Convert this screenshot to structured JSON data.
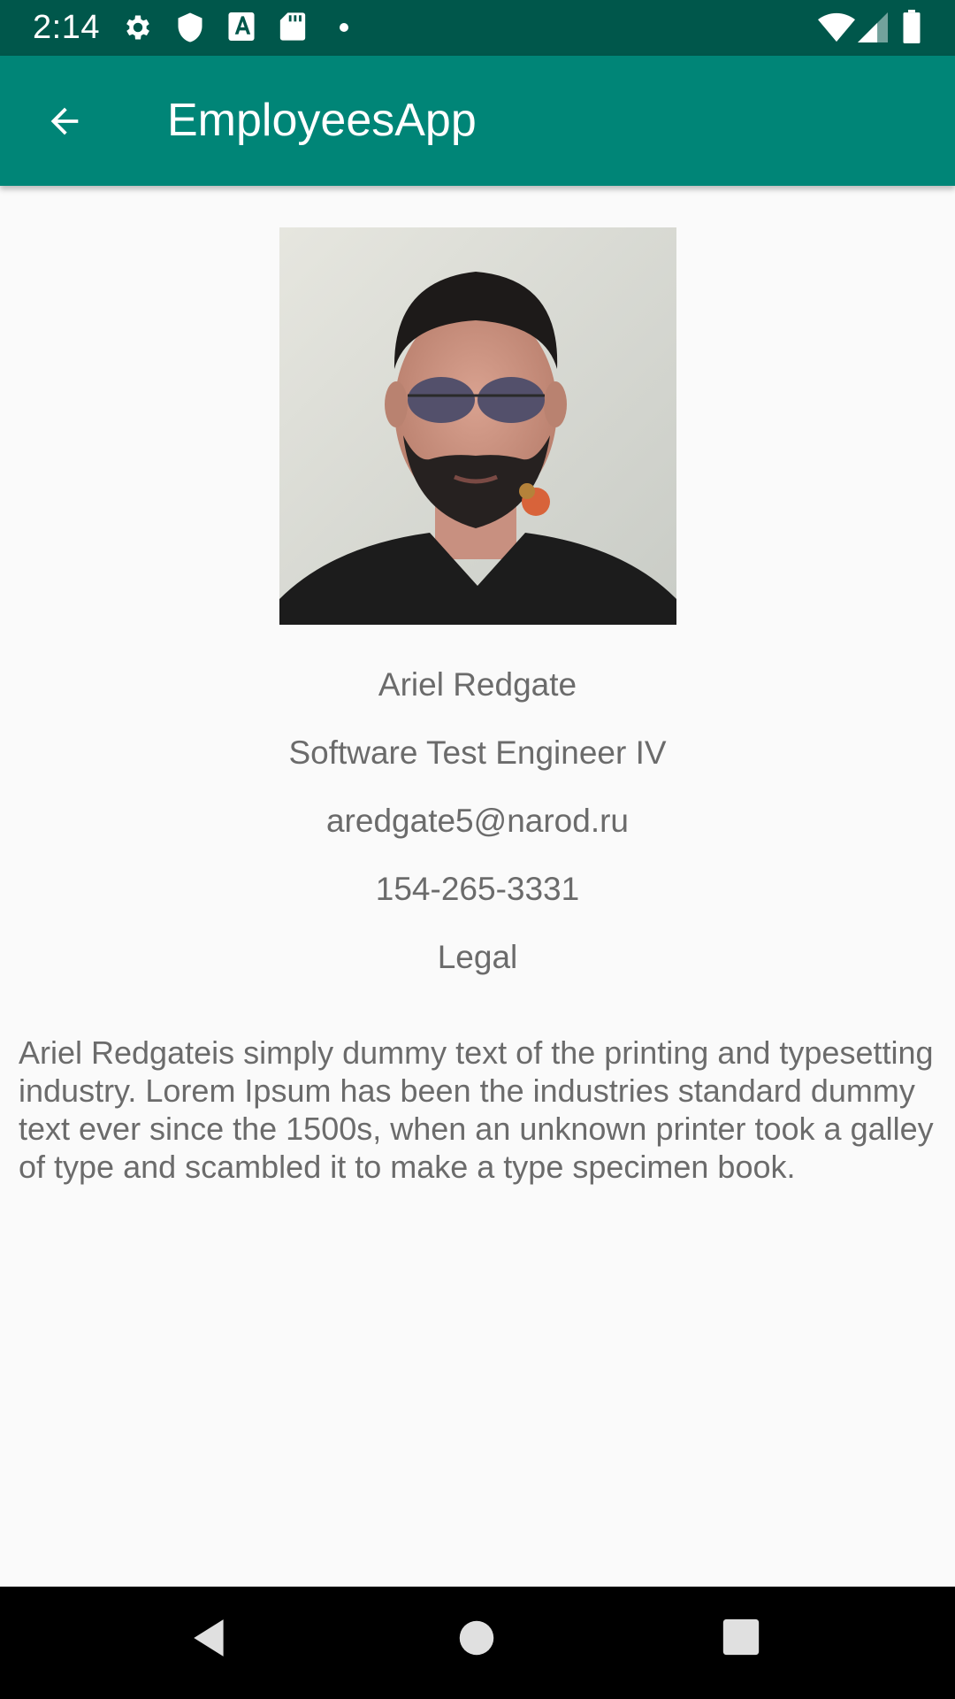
{
  "status_bar": {
    "time": "2:14",
    "icons": [
      "gear-icon",
      "shield-icon",
      "a-badge-icon",
      "sd-card-icon",
      "dot-icon",
      "wifi-icon",
      "signal-icon",
      "battery-icon"
    ]
  },
  "app_bar": {
    "title": "EmployeesApp",
    "back_icon": "arrow-back-icon"
  },
  "employee": {
    "name": "Ariel Redgate",
    "title": "Software Test Engineer IV",
    "email": "aredgate5@narod.ru",
    "phone": "154-265-3331",
    "department": "Legal",
    "bio": "Ariel Redgateis simply dummy text of the printing and typesetting industry. Lorem Ipsum has been the industries standard dummy text ever since the 1500s, when an unknown printer took a galley of type and scambled it to make a type specimen book."
  },
  "nav_bar": {
    "buttons": [
      "back-triangle-icon",
      "home-circle-icon",
      "recents-square-icon"
    ]
  },
  "colors": {
    "status_bar": "#00574b",
    "app_bar": "#008577",
    "background": "#fafafa",
    "text": "#6b6b6b"
  }
}
